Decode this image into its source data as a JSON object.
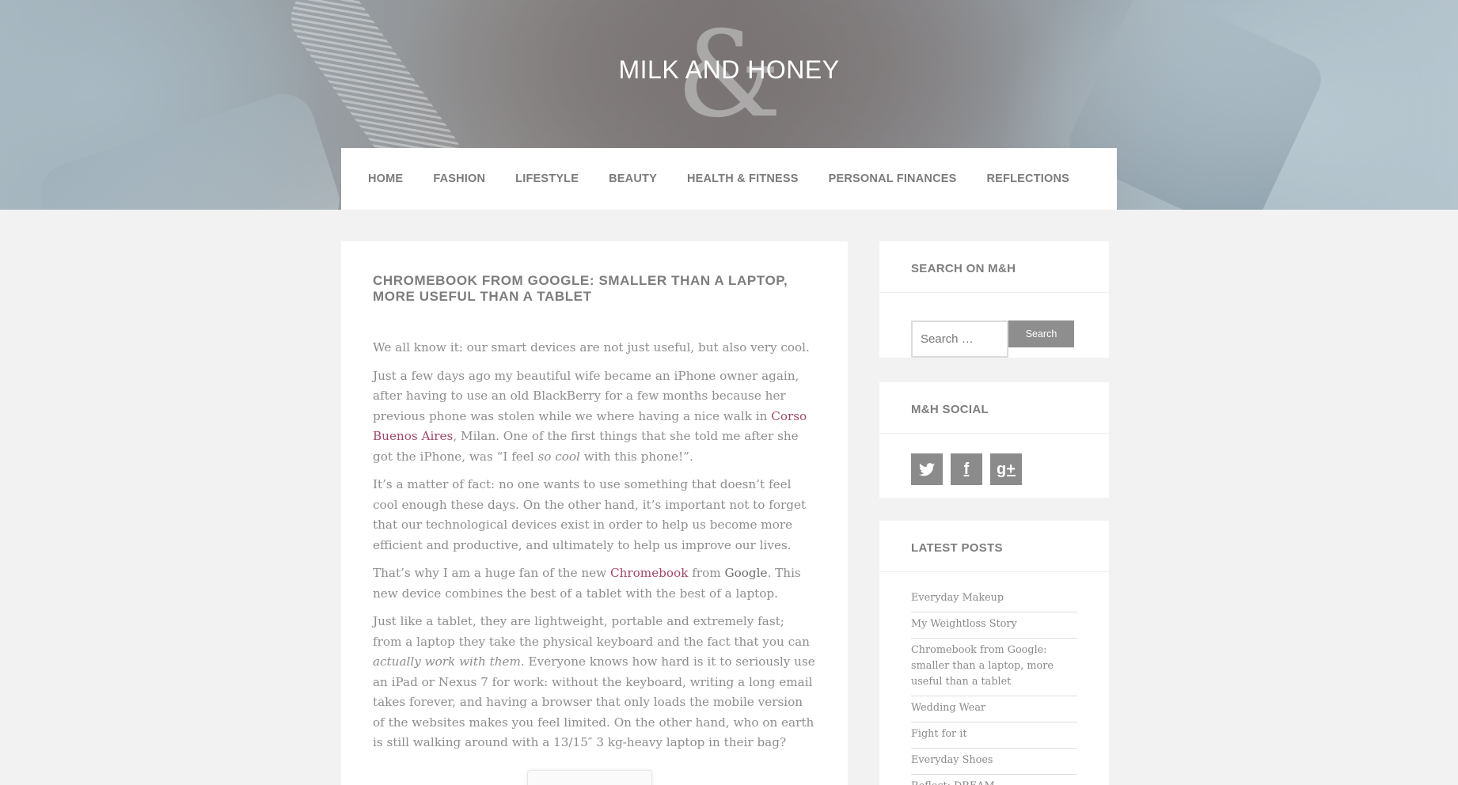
{
  "site": {
    "title": "MILK AND HONEY",
    "ampersand": "&"
  },
  "nav": {
    "items": [
      "HOME",
      "FASHION",
      "LIFESTYLE",
      "BEAUTY",
      "HEALTH & FITNESS",
      "PERSONAL FINANCES",
      "REFLECTIONS"
    ]
  },
  "article": {
    "title": "CHROMEBOOK FROM GOOGLE: SMALLER THAN A LAPTOP, MORE USEFUL THAN A TABLET",
    "p1": "We all know it: our smart devices are not just useful, but also very cool.",
    "p2_a": "Just a few days ago my beautiful wife became an iPhone owner again, after having to use an old BlackBerry for a few months because her previous phone was stolen while we where having a nice walk in ",
    "p2_link": "Corso Buenos Aires",
    "p2_b": ", Milan. One of the first things that she told me after she got the iPhone, was “I feel ",
    "p2_em": "so cool",
    "p2_c": " with this phone!”.",
    "p3": "It’s a matter of fact: no one wants to use something that doesn’t feel cool enough these days. On the other hand, it’s important not to forget that our technological devices exist in order to help us become more efficient and productive, and ultimately to help us improve our lives.",
    "p4_a": "That’s why I am a huge fan of the new ",
    "p4_link": "Chromebook",
    "p4_b": " from ",
    "p4_strong": "Google",
    "p4_c": ". This new device combines the best of a tablet with the best of a laptop.",
    "p5_a": "Just like a tablet, they are lightweight, portable and extremely fast; from a laptop they take the physical keyboard and the fact that you can ",
    "p5_em": "actually work with them",
    "p5_b": ". Everyone knows how hard is it to seriously use an iPad or Nexus 7 for work: without the keyboard, writing a long email takes forever, and having a browser that only loads the mobile version of the websites makes you feel limited. On the other hand, who on earth is still walking around with a 13/15″ 3 kg-heavy laptop in their bag?"
  },
  "sidebar": {
    "search": {
      "title": "SEARCH ON M&H",
      "placeholder": "Search …",
      "button": "Search"
    },
    "social": {
      "title": "M&H SOCIAL",
      "icons": [
        "twitter-icon",
        "facebook-icon",
        "google-plus-icon"
      ],
      "glyphs": [
        "🐦",
        "f",
        "g+"
      ]
    },
    "latest": {
      "title": "LATEST POSTS",
      "posts": [
        "Everyday Makeup",
        "My Weightloss Story",
        "Chromebook from Google: smaller than a laptop, more useful than a tablet",
        "Wedding Wear",
        "Fight for it",
        "Everyday Shoes",
        "Reflect: DREAM"
      ]
    }
  },
  "colors": {
    "link": "#a0486a",
    "text": "#8d8d8d",
    "heading": "#7d7d7d",
    "button": "#8e8e8e"
  }
}
